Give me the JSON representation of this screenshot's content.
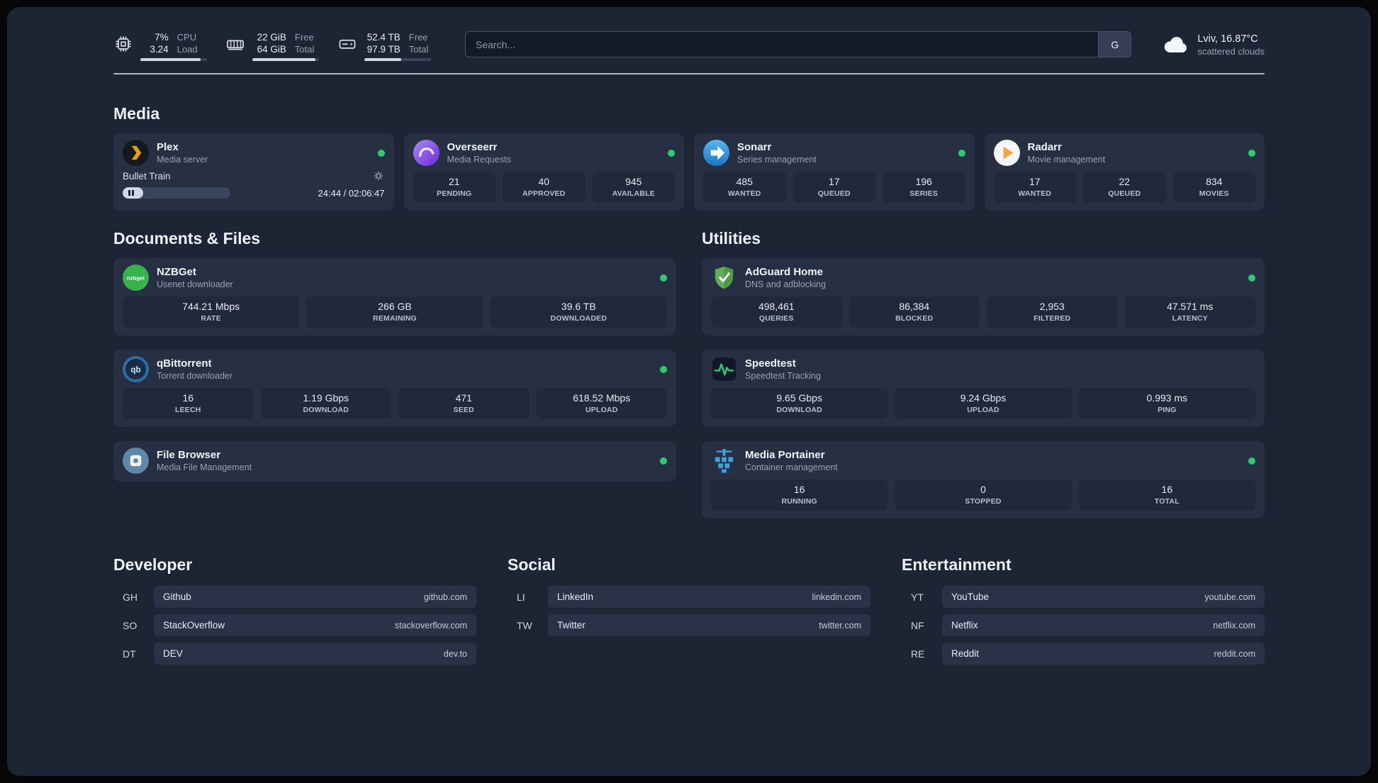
{
  "colors": {
    "status_ok": "#2ecc71",
    "panel_bg": "#1d2434",
    "card_bg": "#272f43"
  },
  "icons": {
    "nzbget_text": "nzbget",
    "qbittorrent_text": "qb"
  },
  "topbar": {
    "cpu": {
      "usage": "7%",
      "load": "3.24",
      "usage_label": "CPU",
      "load_label": "Load",
      "bar_percent": 90
    },
    "memory": {
      "free": "22 GiB",
      "total": "64 GiB",
      "free_label": "Free",
      "total_label": "Total",
      "bar_percent": 95
    },
    "disk": {
      "free": "52.4 TB",
      "total": "97.9 TB",
      "free_label": "Free",
      "total_label": "Total",
      "bar_percent": 55
    },
    "search": {
      "placeholder": "Search...",
      "engine_button": "G"
    },
    "weather": {
      "location_temp": "Lviv, 16.87°C",
      "condition": "scattered clouds"
    }
  },
  "sections": {
    "media": {
      "title": "Media",
      "plex": {
        "name": "Plex",
        "desc": "Media server",
        "player": {
          "track": "Bullet Train",
          "time": "24:44 / 02:06:47",
          "progress_percent": 19
        }
      },
      "overseerr": {
        "name": "Overseerr",
        "desc": "Media Requests",
        "stats": [
          {
            "value": "21",
            "label": "PENDING"
          },
          {
            "value": "40",
            "label": "APPROVED"
          },
          {
            "value": "945",
            "label": "AVAILABLE"
          }
        ]
      },
      "sonarr": {
        "name": "Sonarr",
        "desc": "Series management",
        "stats": [
          {
            "value": "485",
            "label": "WANTED"
          },
          {
            "value": "17",
            "label": "QUEUED"
          },
          {
            "value": "196",
            "label": "SERIES"
          }
        ]
      },
      "radarr": {
        "name": "Radarr",
        "desc": "Movie management",
        "stats": [
          {
            "value": "17",
            "label": "WANTED"
          },
          {
            "value": "22",
            "label": "QUEUED"
          },
          {
            "value": "834",
            "label": "MOVIES"
          }
        ]
      }
    },
    "documents": {
      "title": "Documents & Files",
      "nzbget": {
        "name": "NZBGet",
        "desc": "Usenet downloader",
        "stats": [
          {
            "value": "744.21 Mbps",
            "label": "RATE"
          },
          {
            "value": "266 GB",
            "label": "REMAINING"
          },
          {
            "value": "39.6 TB",
            "label": "DOWNLOADED"
          }
        ]
      },
      "qbittorrent": {
        "name": "qBittorrent",
        "desc": "Torrent downloader",
        "stats": [
          {
            "value": "16",
            "label": "LEECH"
          },
          {
            "value": "1.19 Gbps",
            "label": "DOWNLOAD"
          },
          {
            "value": "471",
            "label": "SEED"
          },
          {
            "value": "618.52 Mbps",
            "label": "UPLOAD"
          }
        ]
      },
      "filebrowser": {
        "name": "File Browser",
        "desc": "Media File Management"
      }
    },
    "utilities": {
      "title": "Utilities",
      "adguard": {
        "name": "AdGuard Home",
        "desc": "DNS and adblocking",
        "stats": [
          {
            "value": "498,461",
            "label": "QUERIES"
          },
          {
            "value": "86,384",
            "label": "BLOCKED"
          },
          {
            "value": "2,953",
            "label": "FILTERED"
          },
          {
            "value": "47.571 ms",
            "label": "LATENCY"
          }
        ]
      },
      "speedtest": {
        "name": "Speedtest",
        "desc": "Speedtest Tracking",
        "stats": [
          {
            "value": "9.65 Gbps",
            "label": "DOWNLOAD"
          },
          {
            "value": "9.24 Gbps",
            "label": "UPLOAD"
          },
          {
            "value": "0.993 ms",
            "label": "PING"
          }
        ]
      },
      "portainer": {
        "name": "Media Portainer",
        "desc": "Container management",
        "stats": [
          {
            "value": "16",
            "label": "RUNNING"
          },
          {
            "value": "0",
            "label": "STOPPED"
          },
          {
            "value": "16",
            "label": "TOTAL"
          }
        ]
      }
    },
    "bookmarks": {
      "developer": {
        "title": "Developer",
        "items": [
          {
            "abbr": "GH",
            "name": "Github",
            "url": "github.com"
          },
          {
            "abbr": "SO",
            "name": "StackOverflow",
            "url": "stackoverflow.com"
          },
          {
            "abbr": "DT",
            "name": "DEV",
            "url": "dev.to"
          }
        ]
      },
      "social": {
        "title": "Social",
        "items": [
          {
            "abbr": "LI",
            "name": "LinkedIn",
            "url": "linkedin.com"
          },
          {
            "abbr": "TW",
            "name": "Twitter",
            "url": "twitter.com"
          }
        ]
      },
      "entertainment": {
        "title": "Entertainment",
        "items": [
          {
            "abbr": "YT",
            "name": "YouTube",
            "url": "youtube.com"
          },
          {
            "abbr": "NF",
            "name": "Netflix",
            "url": "netflix.com"
          },
          {
            "abbr": "RE",
            "name": "Reddit",
            "url": "reddit.com"
          }
        ]
      }
    }
  }
}
